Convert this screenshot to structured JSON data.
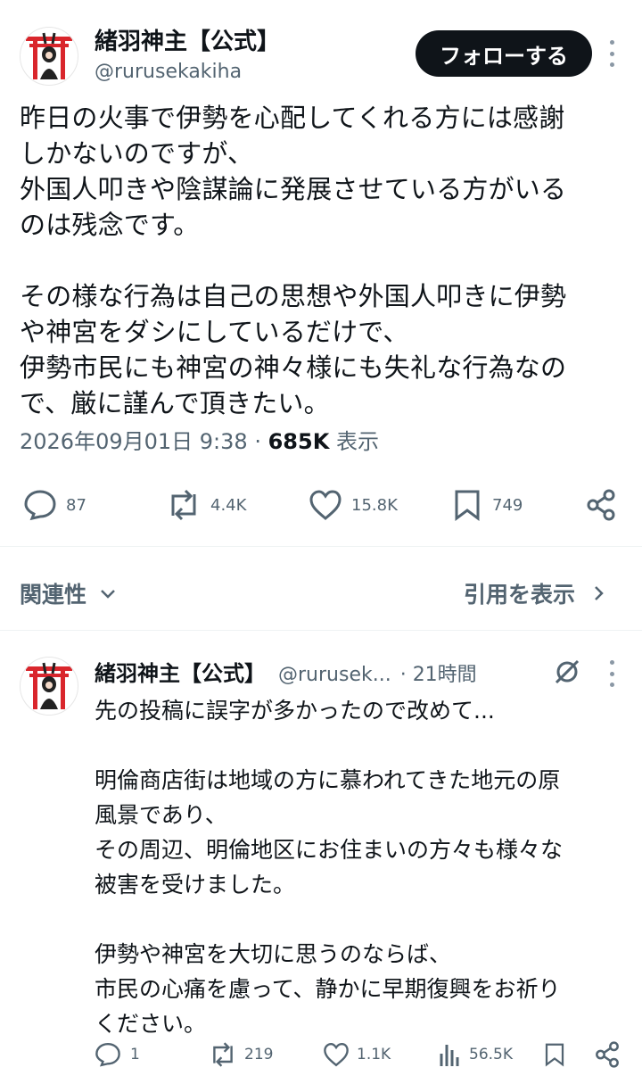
{
  "main_post": {
    "author_name": "緒羽神主【公式】",
    "handle": "@rurusekakiha",
    "follow_label": "フォローする",
    "text": "昨日の火事で伊勢を心配してくれる方には感謝\nしかないのですが、\n外国人叩きや陰謀論に発展させている方がいる\nのは残念です。\n\nその様な行為は自己の思想や外国人叩きに伊勢\nや神宮をダシにしているだけで、\n伊勢市民にも神宮の神々様にも失礼な行為なの\nで、厳に謹んで頂きたい。",
    "timestamp": "2026年09月01日 9:38",
    "separator": "·",
    "views_count": "685K",
    "views_label": "表示",
    "stats": {
      "replies": "87",
      "reposts": "4.4K",
      "likes": "15.8K",
      "bookmarks": "749"
    }
  },
  "section": {
    "relevance_label": "関連性",
    "view_quotes_label": "引用を表示"
  },
  "reply_post": {
    "author_name": "緒羽神主【公式】",
    "handle": "@rurusek...",
    "time": "· 21時間",
    "text": "先の投稿に誤字が多かったので改めて...\n\n明倫商店街は地域の方に慕われてきた地元の原\n風景であり、\nその周辺、明倫地区にお住まいの方々も様々な\n被害を受けました。\n\n伊勢や神宮を大切に思うのならば、\n市民の心痛を慮って、静かに早期復興をお祈り\nください。",
    "stats": {
      "replies": "1",
      "reposts": "219",
      "likes": "1.1K",
      "views": "56.5K"
    }
  },
  "colors": {
    "text": "#0f1419",
    "secondary": "#536471",
    "follow_bg": "#0f1419",
    "torii_red": "#d9262c"
  }
}
